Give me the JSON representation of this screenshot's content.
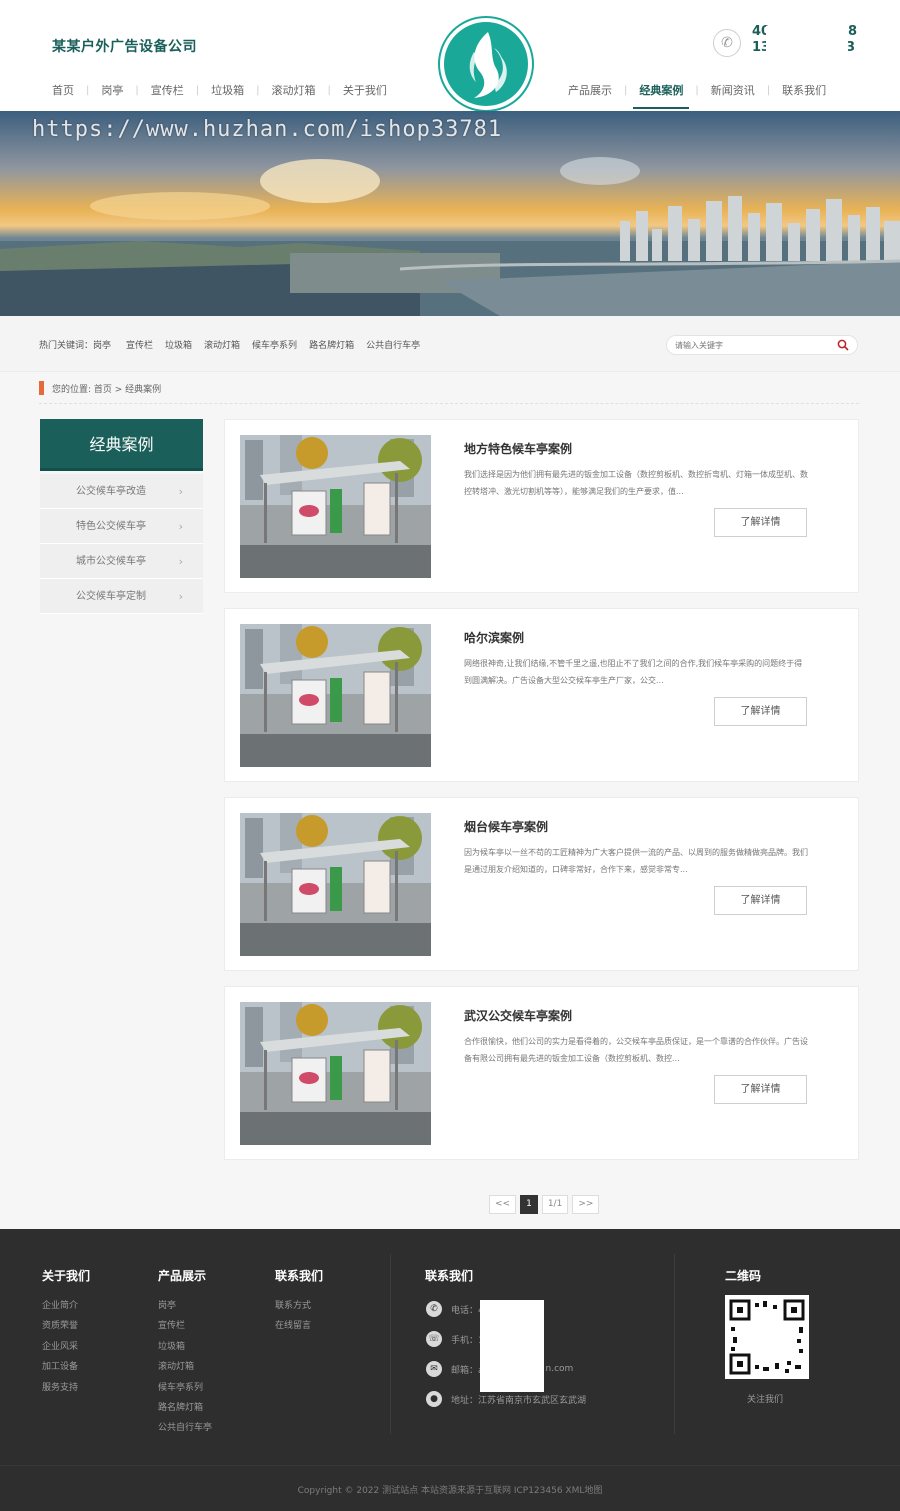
{
  "header": {
    "brand": "某某户外广告设备公司",
    "phone_line1": "40",
    "phone_line2": "13",
    "phone_line1_tail": "8",
    "phone_line2_tail": "3",
    "nav_left": [
      "首页",
      "岗亭",
      "宣传栏",
      "垃圾箱",
      "滚动灯箱",
      "关于我们"
    ],
    "nav_right": [
      "产品展示",
      "经典案例",
      "新闻资讯",
      "联系我们"
    ],
    "active_nav": "经典案例",
    "accent_color": "#1a5f5a",
    "logo_color": "#1aa898"
  },
  "banner": {
    "watermark": "https://www.huzhan.com/ishop33781"
  },
  "keywords": {
    "label": "热门关键词：岗亭",
    "items": [
      "宣传栏",
      "垃圾箱",
      "滚动灯箱",
      "候车亭系列",
      "路名牌灯箱",
      "公共自行车亭"
    ]
  },
  "search": {
    "placeholder": "请输入关键字",
    "icon": "search-icon"
  },
  "breadcrumb": {
    "text": "您的位置: 首页 > 经典案例"
  },
  "sidebar": {
    "title": "经典案例",
    "items": [
      "公交候车亭改造",
      "特色公交候车亭",
      "城市公交候车亭",
      "公交候车亭定制"
    ]
  },
  "cases": [
    {
      "title": "地方特色候车亭案例",
      "desc": "我们选择是因为他们拥有最先进的钣金加工设备（数控剪板机、数控折弯机、灯箱一体成型机、数控转塔冲、激光切割机等等），能够满足我们的生产要求，值...",
      "button": "了解详情"
    },
    {
      "title": "哈尔滨案例",
      "desc": "网络很神奇,让我们结缘,不管千里之遥,也阻止不了我们之间的合作,我们候车亭采购的问题终于得到圆满解决。广告设备大型公交候车亭生产厂家，公交...",
      "button": "了解详情"
    },
    {
      "title": "烟台候车亭案例",
      "desc": "因为候车亭以一丝不苟的工匠精神为广大客户提供一流的产品、以周到的服务做精做亮品牌。我们是通过朋友介绍知道的，口碑非常好，合作下来，感觉非常专...",
      "button": "了解详情"
    },
    {
      "title": "武汉公交候车亭案例",
      "desc": "合作很愉快，他们公司的实力是看得着的，公交候车亭品质保证，是一个靠谱的合作伙伴。广告设备有限公司拥有最先进的钣金加工设备（数控剪板机、数控...",
      "button": "了解详情"
    }
  ],
  "pager": {
    "prev": "<<",
    "current": "1",
    "total": "1/1",
    "next": ">>"
  },
  "footer": {
    "about": {
      "title": "关于我们",
      "links": [
        "企业简介",
        "资质荣誉",
        "企业风采",
        "加工设备",
        "服务支持"
      ]
    },
    "products": {
      "title": "产品展示",
      "links": [
        "岗亭",
        "宣传栏",
        "垃圾箱",
        "滚动灯箱",
        "候车亭系列",
        "路名牌灯箱",
        "公共自行车亭"
      ]
    },
    "contact_links": {
      "title": "联系我们",
      "links": [
        "联系方式",
        "在线留言"
      ]
    },
    "contact": {
      "title": "联系我们",
      "phone": "电话：4",
      "mobile": "手机：1",
      "email_prefix": "邮箱：a",
      "email_suffix": "n.com",
      "address": "地址：江苏省南京市玄武区玄武湖"
    },
    "qr": {
      "title": "二维码",
      "caption": "关注我们"
    },
    "copyright": "Copyright © 2022 测试站点 本站资源来源于互联网  ICP123456  XML地图"
  }
}
